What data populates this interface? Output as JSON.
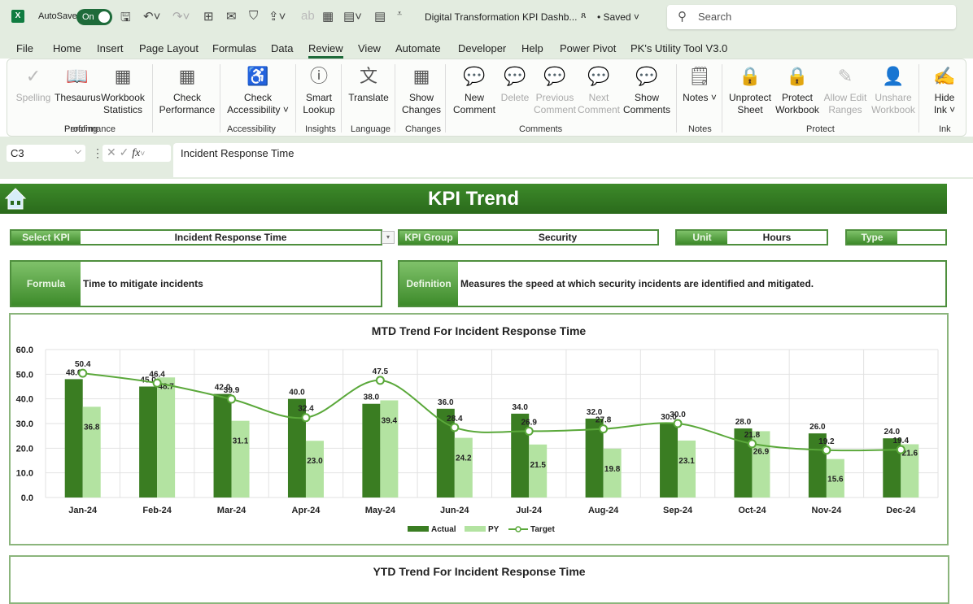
{
  "titlebar": {
    "app_icon": "excel-icon",
    "autosave_label": "AutoSave",
    "autosave_state": "On",
    "doc_title": "Digital Transformation KPI Dashb...",
    "save_status": "• Saved",
    "search_placeholder": "Search"
  },
  "tabs": [
    "File",
    "Home",
    "Insert",
    "Page Layout",
    "Formulas",
    "Data",
    "Review",
    "View",
    "Automate",
    "Developer",
    "Help",
    "Power Pivot",
    "PK's Utility Tool V3.0"
  ],
  "active_tab": "Review",
  "ribbon": {
    "buttons": [
      {
        "label": "Spelling",
        "icon": "spelling-icon",
        "disabled": true
      },
      {
        "label": "Thesaurus",
        "icon": "thesaurus-icon"
      },
      {
        "label": "Workbook Statistics",
        "icon": "workbook-statistics-icon"
      },
      {
        "label": "Check Performance",
        "icon": "check-performance-icon"
      },
      {
        "label": "Check Accessibility ˅",
        "icon": "accessibility-icon"
      },
      {
        "label": "Smart Lookup",
        "icon": "smart-lookup-icon"
      },
      {
        "label": "Translate",
        "icon": "translate-icon"
      },
      {
        "label": "Show Changes",
        "icon": "show-changes-icon"
      },
      {
        "label": "New Comment",
        "icon": "new-comment-icon"
      },
      {
        "label": "Delete",
        "icon": "delete-comment-icon",
        "disabled": true
      },
      {
        "label": "Previous Comment",
        "icon": "previous-comment-icon",
        "disabled": true
      },
      {
        "label": "Next Comment",
        "icon": "next-comment-icon",
        "disabled": true
      },
      {
        "label": "Show Comments",
        "icon": "show-comments-icon"
      },
      {
        "label": "Notes ˅",
        "icon": "notes-icon"
      },
      {
        "label": "Unprotect Sheet",
        "icon": "unprotect-sheet-icon"
      },
      {
        "label": "Protect Workbook",
        "icon": "protect-workbook-icon"
      },
      {
        "label": "Allow Edit Ranges",
        "icon": "allow-edit-ranges-icon",
        "disabled": true
      },
      {
        "label": "Unshare Workbook",
        "icon": "unshare-workbook-icon",
        "disabled": true
      },
      {
        "label": "Hide Ink ˅",
        "icon": "hide-ink-icon"
      }
    ],
    "groups": [
      "Proofing",
      "Performance",
      "Accessibility",
      "Insights",
      "Language",
      "Changes",
      "Comments",
      "Notes",
      "Protect",
      "Ink"
    ]
  },
  "formula_bar": {
    "name_box": "C3",
    "content": "Incident Response Time"
  },
  "dashboard": {
    "title": "KPI Trend",
    "select_kpi_label": "Select KPI",
    "select_kpi_value": "Incident Response Time",
    "kpi_group_label": "KPI Group",
    "kpi_group_value": "Security",
    "unit_label": "Unit",
    "unit_value": "Hours",
    "type_label": "Type",
    "type_value": "",
    "formula_label": "Formula",
    "formula_value": "Time to mitigate incidents",
    "definition_label": "Definition",
    "definition_value": "Measures the speed at which security incidents are identified and mitigated.",
    "ytd_title": "YTD Trend For Incident Response Time"
  },
  "colors": {
    "actual": "#3a7d22",
    "py": "#b3e3a1",
    "target": "#5aa83a",
    "banner": "#2f7320"
  },
  "chart_data": {
    "type": "bar",
    "title": "MTD Trend For Incident Response Time",
    "categories": [
      "Jan-24",
      "Feb-24",
      "Mar-24",
      "Apr-24",
      "May-24",
      "Jun-24",
      "Jul-24",
      "Aug-24",
      "Sep-24",
      "Oct-24",
      "Nov-24",
      "Dec-24"
    ],
    "series": [
      {
        "name": "Actual",
        "type": "bar",
        "values": [
          48.0,
          45.0,
          42.0,
          40.0,
          38.0,
          36.0,
          34.0,
          32.0,
          30.0,
          28.0,
          26.0,
          24.0
        ]
      },
      {
        "name": "PY",
        "type": "bar",
        "values": [
          36.8,
          48.7,
          31.1,
          23.0,
          39.4,
          24.2,
          21.5,
          19.8,
          23.1,
          26.9,
          15.6,
          21.6
        ]
      },
      {
        "name": "Target",
        "type": "line",
        "values": [
          50.4,
          46.4,
          39.9,
          32.4,
          47.5,
          28.4,
          26.9,
          27.8,
          30.0,
          21.8,
          19.2,
          19.4
        ]
      }
    ],
    "ylim": [
      0,
      60
    ],
    "yticks": [
      "0.0",
      "10.0",
      "20.0",
      "30.0",
      "40.0",
      "50.0",
      "60.0"
    ],
    "xlabel": "",
    "ylabel": "",
    "grid": true,
    "legend": "bottom"
  }
}
